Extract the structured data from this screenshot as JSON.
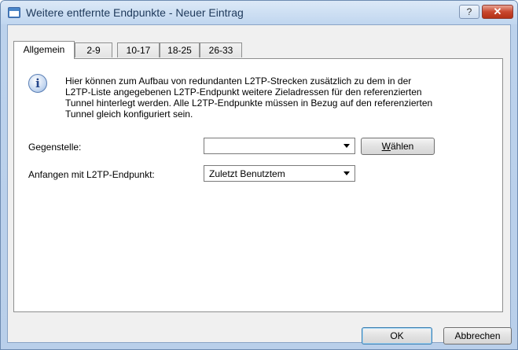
{
  "window": {
    "title": "Weitere entfernte Endpunkte - Neuer Eintrag",
    "help_label": "?",
    "close_label": "✕"
  },
  "tabs": [
    {
      "label": "Allgemein",
      "active": true
    },
    {
      "label": "2-9",
      "active": false
    },
    {
      "label": "10-17",
      "active": false
    },
    {
      "label": "18-25",
      "active": false
    },
    {
      "label": "26-33",
      "active": false
    }
  ],
  "info": {
    "icon": "info-icon",
    "lines": [
      "Hier können zum Aufbau von redundanten L2TP-Strecken zusätzlich zu dem in der",
      "L2TP-Liste angegebenen L2TP-Endpunkt weitere Zieladressen für den referenzierten",
      "Tunnel hinterlegt werden. Alle L2TP-Endpunkte müssen in Bezug auf den referenzierten",
      "Tunnel gleich konfiguriert sein."
    ]
  },
  "form": {
    "gegenstelle_label": "Gegenstelle:",
    "gegenstelle_value": "",
    "waehlen_label": "Wählen",
    "waehlen_underline": "W",
    "waehlen_rest": "ählen",
    "anfangen_label": "Anfangen mit L2TP-Endpunkt:",
    "anfangen_value": "Zuletzt Benutztem"
  },
  "buttons": {
    "ok": "OK",
    "cancel": "Abbrechen"
  }
}
